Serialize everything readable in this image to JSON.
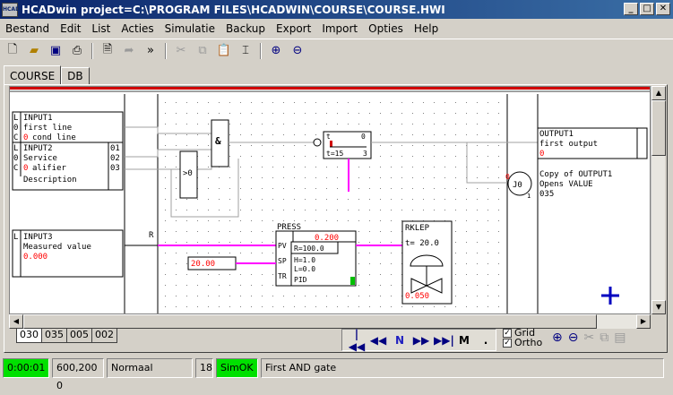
{
  "window": {
    "title": "HCADwin project=C:\\PROGRAM FILES\\HCADWIN\\COURSE\\COURSE.HWI",
    "app_icon_text": "HCAD",
    "controls": [
      "_",
      "□",
      "✕"
    ]
  },
  "menu": [
    "Bestand",
    "Edit",
    "List",
    "Acties",
    "Simulatie",
    "Backup",
    "Export",
    "Import",
    "Opties",
    "Help"
  ],
  "toolbar": {
    "icons": [
      "new-file-icon",
      "open-folder-icon",
      "save-icon",
      "print-icon",
      "preview-icon",
      "step-icon",
      "run-icon",
      "cut-icon",
      "copy-icon",
      "paste-icon",
      "align-icon",
      "zoom-in-icon",
      "zoom-out-icon"
    ]
  },
  "tabs": [
    "COURSE",
    "DB"
  ],
  "diagram": {
    "input1": {
      "name": "INPUT1",
      "line1": "first line",
      "line2": "cond line",
      "flags": [
        "L",
        "0",
        "C"
      ],
      "flag_value": "0"
    },
    "input2": {
      "name": "INPUT2",
      "line1": "Service",
      "line2": "alifier",
      "line3": "Description",
      "flags": [
        "L",
        "0",
        "C"
      ],
      "flag_value": "0",
      "outputs": [
        "01",
        "02",
        "03"
      ]
    },
    "input3": {
      "name": "INPUT3",
      "line1": "Measured value",
      "value": "0.000",
      "flags": [
        "L"
      ]
    },
    "r_label": "R",
    "and_gate": "&",
    "gt_gate": ">0",
    "timer": {
      "t_label": "t",
      "zero": "0",
      "t_value": "t=15",
      "three": "3"
    },
    "output1": {
      "name": "OUTPUT1",
      "line1": "first output",
      "value": "0",
      "copy1": "Copy of OUTPUT1",
      "copy2": "Opens VALUE",
      "copy3": "035"
    },
    "valve_circle": {
      "zero": "0",
      "label": "J0",
      "one": "1"
    },
    "pid": {
      "name": "PRESS",
      "value": "0.200",
      "pv": "PV",
      "sp": "SP",
      "tr": "TR",
      "r": "R=100.0",
      "h": "H=1.0",
      "l": "L=0.0",
      "mode": "PID"
    },
    "setpoint": "20.00",
    "rklep": {
      "name": "RKLEP",
      "t": "t= 20.0",
      "value": "0.050"
    }
  },
  "page_tabs": [
    "030",
    "035",
    "005",
    "002"
  ],
  "nav": [
    "|◀◀",
    "◀◀",
    "N",
    "▶▶",
    "▶▶|",
    "M",
    "."
  ],
  "checks": {
    "grid": "Grid",
    "ortho": "Ortho"
  },
  "status": {
    "time": "0:00:01",
    "coords": "600,200 0",
    "mode": "Normaal",
    "count": "18",
    "sim": "SimOK",
    "message": "First AND gate"
  },
  "colors": {
    "magenta": "#ff00ff",
    "status_green": "#00e000",
    "title_blue": "#0a246a",
    "red_value": "#ff0000"
  }
}
